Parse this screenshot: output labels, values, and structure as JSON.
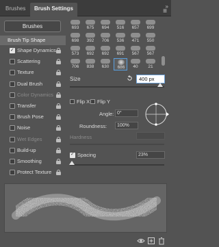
{
  "tabs": [
    {
      "label": "Brushes"
    },
    {
      "label": "Brush Settings"
    }
  ],
  "header": {
    "collapse_glyph": "»",
    "menu_icon": "panel-menu-icon"
  },
  "left_panel": {
    "brushes_button": "Brushes",
    "section_title": "Brush Tip Shape",
    "options": [
      {
        "label": "Shape Dynamics",
        "checked": true,
        "enabled": true
      },
      {
        "label": "Scattering",
        "checked": false,
        "enabled": true
      },
      {
        "label": "Texture",
        "checked": false,
        "enabled": true
      },
      {
        "label": "Dual Brush",
        "checked": false,
        "enabled": true
      },
      {
        "label": "Color Dynamics",
        "checked": false,
        "enabled": false
      },
      {
        "label": "Transfer",
        "checked": false,
        "enabled": true
      },
      {
        "label": "Brush Pose",
        "checked": false,
        "enabled": true
      },
      {
        "label": "Noise",
        "checked": false,
        "enabled": true
      },
      {
        "label": "Wet Edges",
        "checked": false,
        "enabled": false
      },
      {
        "label": "Build-up",
        "checked": false,
        "enabled": true
      },
      {
        "label": "Smoothing",
        "checked": false,
        "enabled": true
      },
      {
        "label": "Protect Texture",
        "checked": false,
        "enabled": true
      }
    ]
  },
  "brush_grid": {
    "rows": [
      [
        "693",
        "675",
        "694",
        "516",
        "657",
        "699"
      ],
      [
        "698",
        "392",
        "706",
        "536",
        "471",
        "550"
      ],
      [
        "573",
        "692",
        "692",
        "691",
        "567",
        "567"
      ],
      [
        "706",
        "838",
        "630",
        "686",
        "40",
        "21"
      ]
    ],
    "selected": "686"
  },
  "size": {
    "label": "Size",
    "value": "400 px",
    "slider_fraction": 0.96
  },
  "flip": {
    "x_label": "Flip X",
    "y_label": "Flip Y"
  },
  "angle": {
    "label": "Angle:",
    "value": "0°"
  },
  "roundness": {
    "label": "Roundness:",
    "value": "100%"
  },
  "hardness": {
    "label": "Hardness"
  },
  "spacing": {
    "label": "Spacing",
    "value": "23%",
    "checked": true,
    "slider_fraction": 0.02
  },
  "colors": {
    "accent": "#5aa0e0",
    "panel": "#535353",
    "preview_bg": "#656565"
  }
}
